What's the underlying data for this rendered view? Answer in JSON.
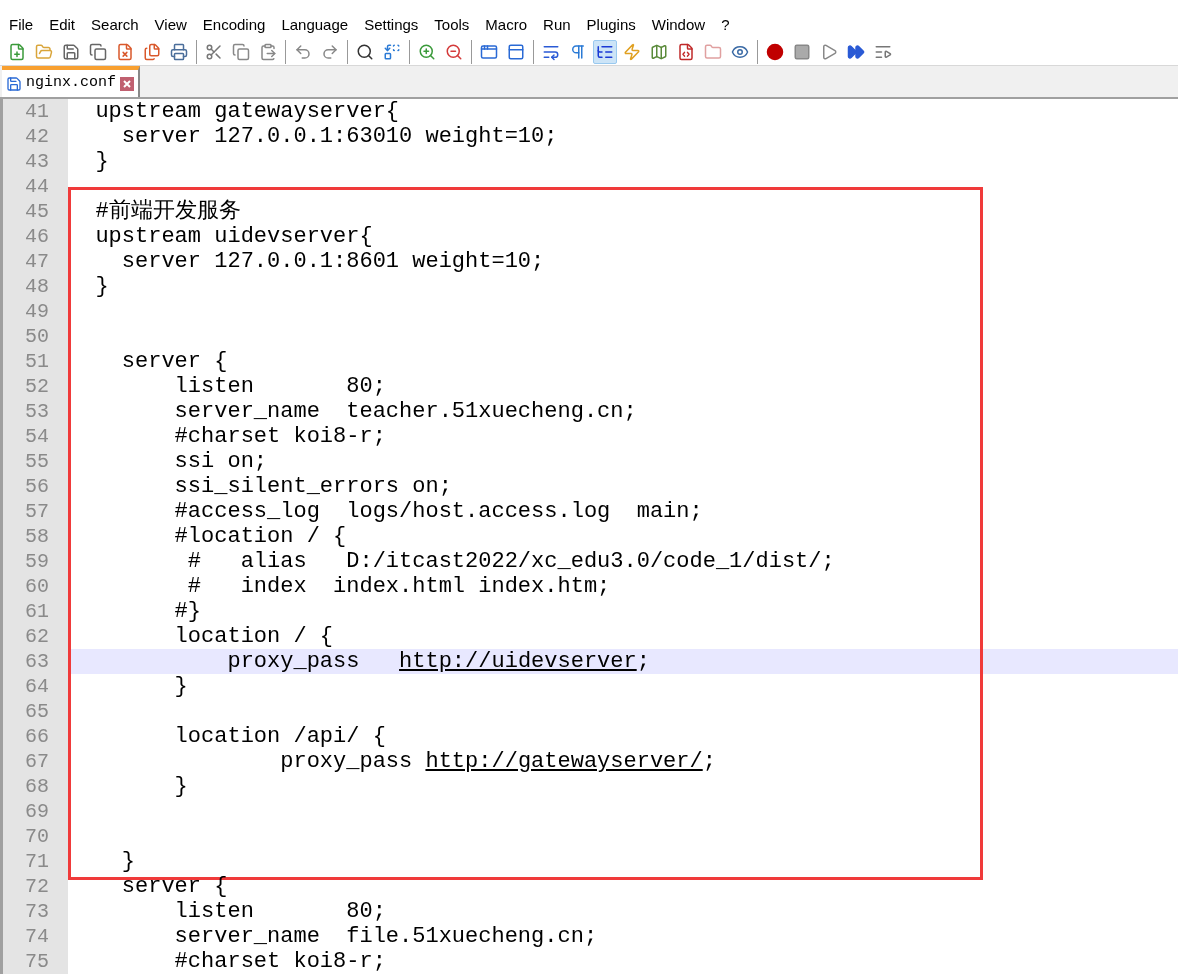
{
  "menu": [
    "File",
    "Edit",
    "Search",
    "View",
    "Encoding",
    "Language",
    "Settings",
    "Tools",
    "Macro",
    "Run",
    "Plugins",
    "Window",
    "?"
  ],
  "toolbar": [
    [
      {
        "pressed": false
      },
      {
        "pressed": false
      },
      {
        "pressed": false
      },
      {
        "pressed": false
      },
      {
        "pressed": false
      },
      {
        "pressed": false
      },
      {
        "pressed": false
      }
    ],
    [
      {
        "pressed": false
      },
      {
        "pressed": false
      },
      {
        "pressed": false
      }
    ],
    [
      {
        "pressed": false
      },
      {
        "pressed": false
      }
    ],
    [
      {
        "pressed": false
      },
      {
        "pressed": false
      }
    ],
    [
      {
        "pressed": false
      },
      {
        "pressed": false
      }
    ],
    [
      {
        "pressed": false
      },
      {
        "pressed": false
      }
    ],
    [
      {
        "pressed": false
      },
      {
        "pressed": false
      },
      {
        "pressed": true
      },
      {
        "pressed": false
      },
      {
        "pressed": false
      },
      {
        "pressed": false
      },
      {
        "pressed": false
      },
      {
        "pressed": false
      }
    ],
    [
      {
        "pressed": false
      },
      {
        "pressed": false
      },
      {
        "pressed": false
      },
      {
        "pressed": false
      },
      {
        "pressed": false
      }
    ]
  ],
  "tabs": [
    {
      "label": "nginx.conf",
      "selected": true
    }
  ],
  "editor": {
    "blocks": [
      {
        "boxed": false,
        "lines": [
          {
            "n": "41",
            "text": "  upstream gatewayserver{",
            "current": false
          },
          {
            "n": "42",
            "text": "    server 127.0.0.1:63010 weight=10;",
            "current": false
          },
          {
            "n": "43",
            "text": "  }",
            "current": false
          },
          {
            "n": "44",
            "current": false
          }
        ]
      },
      {
        "boxed": true,
        "lines": [
          {
            "n": "45",
            "text": "  #前端开发服务",
            "current": false
          },
          {
            "n": "46",
            "text": "  upstream uidevserver{",
            "current": false
          },
          {
            "n": "47",
            "text": "    server 127.0.0.1:8601 weight=10;",
            "current": false
          },
          {
            "n": "48",
            "text": "  }",
            "current": false
          },
          {
            "n": "49",
            "current": false
          },
          {
            "n": "50",
            "current": false
          },
          {
            "n": "51",
            "text": "    server {",
            "current": false
          },
          {
            "n": "52",
            "text": "        listen       80;",
            "current": false
          },
          {
            "n": "53",
            "text": "        server_name  teacher.51xuecheng.cn;",
            "current": false
          },
          {
            "n": "54",
            "text": "        #charset koi8-r;",
            "current": false
          },
          {
            "n": "55",
            "text": "        ssi on;",
            "current": false
          },
          {
            "n": "56",
            "text": "        ssi_silent_errors on;",
            "current": false
          },
          {
            "n": "57",
            "text": "        #access_log  logs/host.access.log  main;",
            "current": false
          },
          {
            "n": "58",
            "text": "        #location / {",
            "current": false
          },
          {
            "n": "59",
            "text": "         #   alias   D:/itcast2022/xc_edu3.0/code_1/dist/;",
            "current": false
          },
          {
            "n": "60",
            "text": "         #   index  index.html index.htm;",
            "current": false
          },
          {
            "n": "61",
            "text": "        #}",
            "current": false
          },
          {
            "n": "62",
            "text": "        location / {",
            "current": false
          },
          {
            "n": "63",
            "text": "            proxy_pass   ",
            "link": "http://uidevserver",
            "after": ";",
            "current": true
          },
          {
            "n": "64",
            "text": "        }",
            "current": false
          },
          {
            "n": "65",
            "current": false
          },
          {
            "n": "66",
            "text": "        location /api/ {",
            "current": false
          },
          {
            "n": "67",
            "text": "                proxy_pass ",
            "link": "http://gatewayserver/",
            "after": ";",
            "current": false
          },
          {
            "n": "68",
            "text": "        }",
            "current": false
          },
          {
            "n": "69",
            "current": false
          },
          {
            "n": "70",
            "current": false
          },
          {
            "n": "71",
            "text": "    }",
            "current": false
          }
        ]
      },
      {
        "boxed": false,
        "lines": [
          {
            "n": "72",
            "text": "    server {",
            "current": false
          },
          {
            "n": "73",
            "text": "        listen       80;",
            "current": false
          },
          {
            "n": "74",
            "text": "        server_name  file.51xuecheng.cn;",
            "current": false
          },
          {
            "n": "75",
            "text": "        #charset koi8-r;",
            "current": false
          }
        ]
      }
    ]
  }
}
